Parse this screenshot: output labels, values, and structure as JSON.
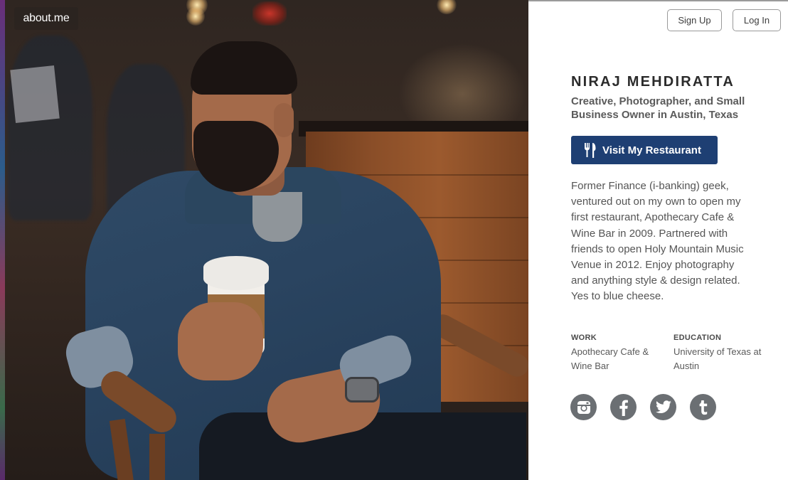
{
  "brand": {
    "logo_text": "about.me"
  },
  "header": {
    "signup_label": "Sign Up",
    "login_label": "Log In"
  },
  "profile": {
    "name": "NIRAJ MEHDIRATTA",
    "headline": "Creative, Photographer, and Small Business Owner in Austin, Texas",
    "cta_label": "Visit My Restaurant",
    "cta_icon": "fork-knife-icon",
    "bio": "Former Finance (i-banking) geek, ventured out on my own to open my first restaurant, Apothecary Cafe & Wine Bar in 2009. Partnered with friends to open Holy Mountain Music Venue in 2012. Enjoy photography and anything style & design related. Yes to blue cheese.",
    "work_label": "WORK",
    "work_value": "Apothecary Cafe & Wine Bar",
    "education_label": "EDUCATION",
    "education_value": "University of Texas at Austin"
  },
  "social": [
    "instagram-icon",
    "facebook-icon",
    "twitter-icon",
    "tumblr-icon"
  ],
  "colors": {
    "cta_background": "#1e3f73",
    "social_icon_background": "#6b6f73",
    "panel_background": "#ffffff"
  }
}
